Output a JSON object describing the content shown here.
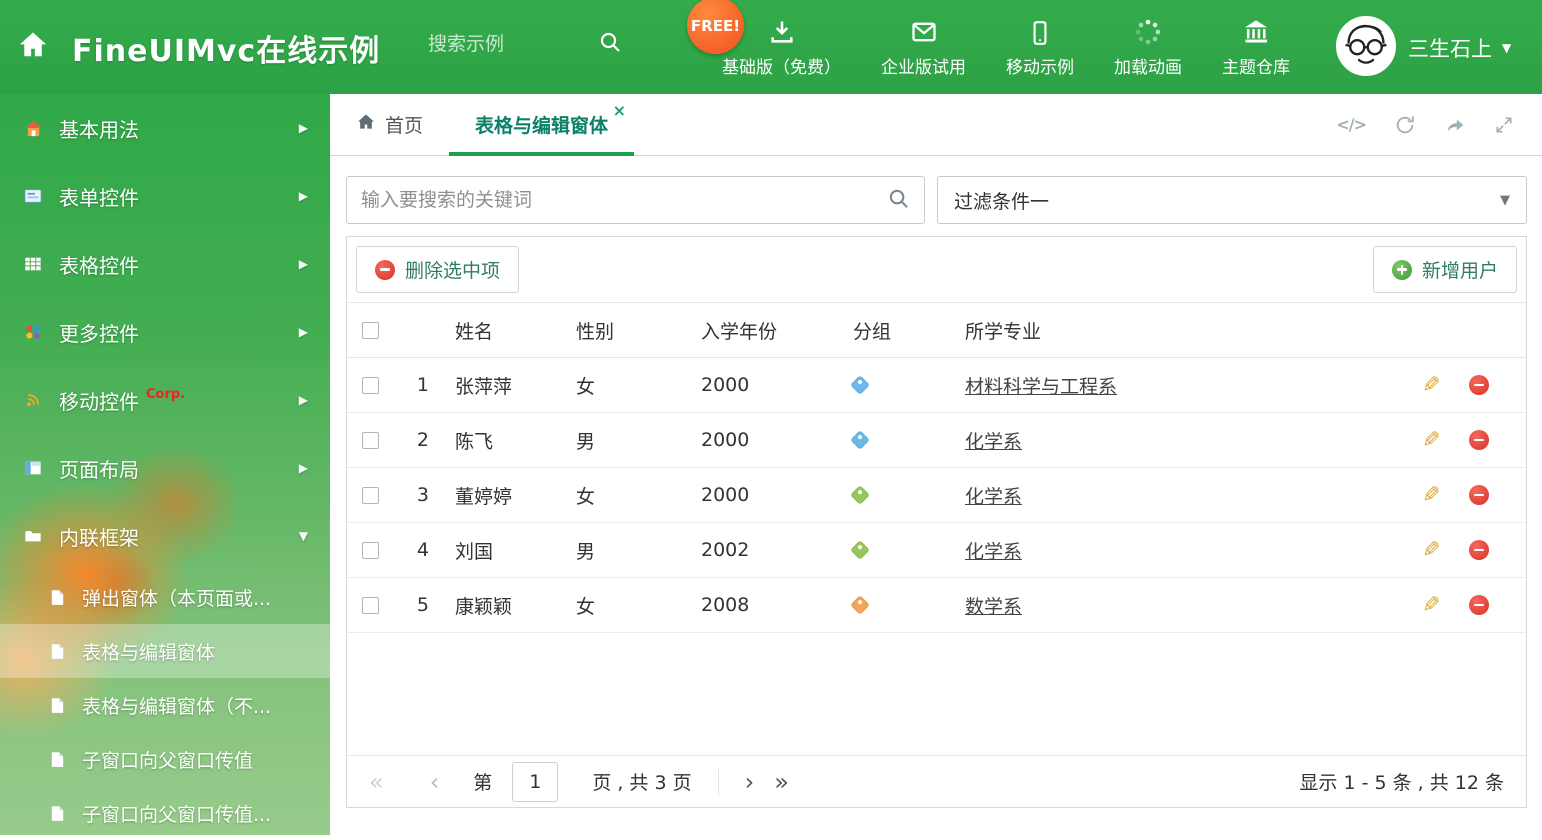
{
  "colors": {
    "header_green": "#2fa848",
    "accent_teal": "#0d8168",
    "tab_underline": "#1ea04d",
    "delete_red": "#d93025",
    "add_green": "#3d9a35",
    "edit_yellow": "#d9a62e"
  },
  "header": {
    "title": "FineUIMvc在线示例",
    "search_placeholder": "搜索示例",
    "free_badge": "FREE!",
    "nav": [
      {
        "label": "基础版（免费）"
      },
      {
        "label": "企业版试用"
      },
      {
        "label": "移动示例"
      },
      {
        "label": "加载动画"
      },
      {
        "label": "主题仓库"
      }
    ],
    "user_name": "三生石上",
    "user_caret": "▼"
  },
  "sidebar": {
    "items": [
      {
        "label": "基本用法",
        "chevron": "▶"
      },
      {
        "label": "表单控件",
        "chevron": "▶"
      },
      {
        "label": "表格控件",
        "chevron": "▶"
      },
      {
        "label": "更多控件",
        "chevron": "▶"
      },
      {
        "label": "移动控件",
        "badge": "Corp.",
        "chevron": "▶"
      },
      {
        "label": "页面布局",
        "chevron": "▶"
      },
      {
        "label": "内联框架",
        "chevron": "▼"
      }
    ],
    "subitems": [
      {
        "label": "弹出窗体（本页面或..."
      },
      {
        "label": "表格与编辑窗体"
      },
      {
        "label": "表格与编辑窗体（不..."
      },
      {
        "label": "子窗口向父窗口传值"
      },
      {
        "label": "子窗口向父窗口传值..."
      }
    ]
  },
  "tabs": {
    "home": "首页",
    "active": "表格与编辑窗体",
    "close": "×"
  },
  "filterbar": {
    "search_placeholder": "输入要搜索的关键词",
    "filter_label": "过滤条件一",
    "caret": "▼"
  },
  "grid": {
    "delete_button": "删除选中项",
    "add_button": "新增用户",
    "columns": {
      "name": "姓名",
      "gender": "性别",
      "year": "入学年份",
      "group": "分组",
      "major": "所学专业"
    },
    "rows": [
      {
        "num": "1",
        "name": "张萍萍",
        "gender": "女",
        "year": "2000",
        "tag_color": "#6cb8e8",
        "major": "材料科学与工程系"
      },
      {
        "num": "2",
        "name": "陈飞",
        "gender": "男",
        "year": "2000",
        "tag_color": "#6cb8e8",
        "major": "化学系"
      },
      {
        "num": "3",
        "name": "董婷婷",
        "gender": "女",
        "year": "2000",
        "tag_color": "#95c75a",
        "major": "化学系"
      },
      {
        "num": "4",
        "name": "刘国",
        "gender": "男",
        "year": "2002",
        "tag_color": "#95c75a",
        "major": "化学系"
      },
      {
        "num": "5",
        "name": "康颖颖",
        "gender": "女",
        "year": "2008",
        "tag_color": "#f5a55a",
        "major": "数学系"
      }
    ]
  },
  "pagination": {
    "first": "«",
    "prev": "‹",
    "page_prefix": "第",
    "page_value": "1",
    "page_suffix": "页 , 共 3 页",
    "next": "›",
    "last": "»",
    "summary": "显示 1 - 5 条 , 共 12 条"
  },
  "icons": {
    "edit": "✎",
    "code": "</>"
  }
}
